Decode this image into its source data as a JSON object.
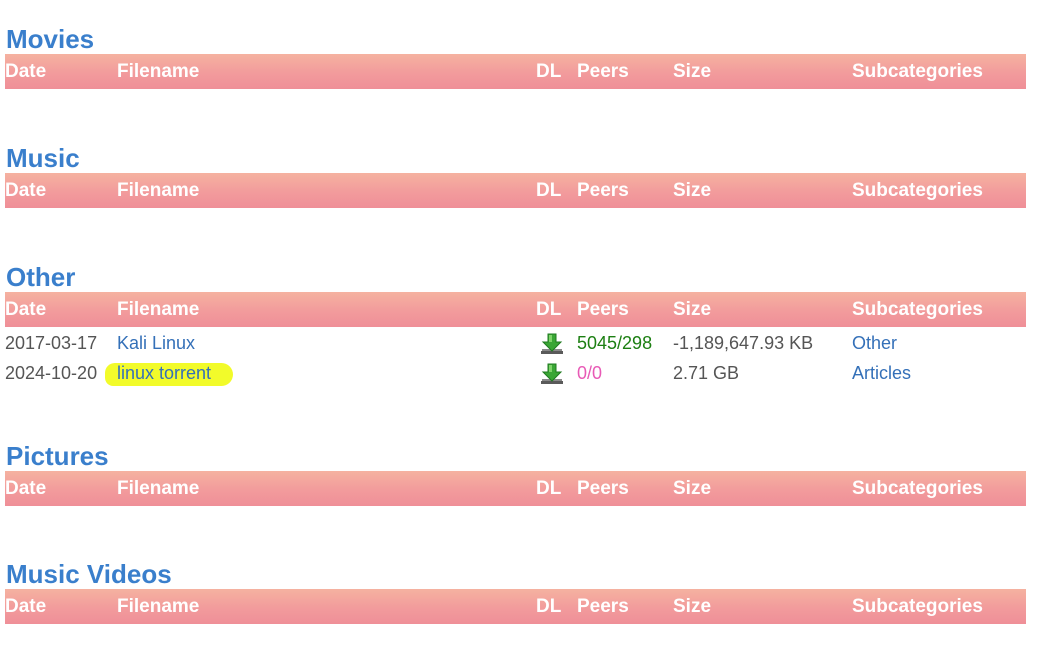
{
  "columns": {
    "date": "Date",
    "filename": "Filename",
    "dl": "DL",
    "peers": "Peers",
    "size": "Size",
    "subcategories": "Subcategories"
  },
  "sections": [
    {
      "title": "Movies",
      "rows": []
    },
    {
      "title": "Music",
      "rows": []
    },
    {
      "title": "Other",
      "rows": [
        {
          "date": "2017-03-17",
          "filename": "Kali Linux",
          "peers": "5045/298",
          "size": "-1,189,647.93 KB",
          "subcategory": "Other",
          "peers_color": "#1c7f12",
          "highlighted": false
        },
        {
          "date": "2024-10-20",
          "filename": "linux torrent",
          "peers": "0/0",
          "size": "2.71 GB",
          "subcategory": "Articles",
          "peers_color": "#e85ab6",
          "highlighted": true
        }
      ]
    },
    {
      "title": "Pictures",
      "rows": []
    },
    {
      "title": "Music Videos",
      "rows": []
    }
  ],
  "icons": {
    "download": "download-arrow-icon"
  },
  "colors": {
    "section_title": "#3a7fcc",
    "header_gradient_top": "#f5b2a0",
    "header_gradient_bottom": "#ef8f98",
    "link": "#3470b8",
    "highlight": "#f2fb2a"
  }
}
